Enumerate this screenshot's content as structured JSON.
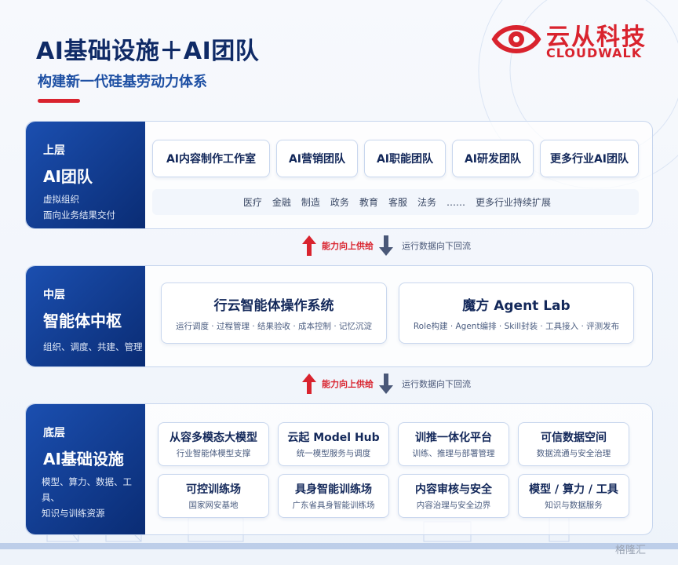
{
  "header": {
    "title": "AI基础设施＋AI团队",
    "subtitle": "构建新一代硅基劳动力体系"
  },
  "logo": {
    "cn": "云从科技",
    "en": "CLOUDWALK",
    "icon": "eye-logo-icon",
    "color": "#d9232e"
  },
  "top_layer": {
    "tier": "上层",
    "name": "AI团队",
    "desc": [
      "虚拟组织",
      "面向业务结果交付"
    ],
    "cards": [
      "AI内容制作工作室",
      "AI营销团队",
      "AI职能团队",
      "AI研发团队",
      "更多行业AI团队"
    ],
    "industries": [
      "医疗",
      "金融",
      "制造",
      "政务",
      "教育",
      "客服",
      "法务",
      "……",
      "更多行业持续扩展"
    ]
  },
  "flow": {
    "up_label": "能力向上供给",
    "down_label": "运行数据向下回流",
    "up_color": "#d9232e",
    "down_color": "#4a5878"
  },
  "middle_layer": {
    "tier": "中层",
    "name": "智能体中枢",
    "desc": "组织、调度、共建、管理",
    "cards": [
      {
        "title": "行云智能体操作系统",
        "sub": "运行调度 · 过程管理 · 结果验收 · 成本控制 · 记忆沉淀"
      },
      {
        "title": "魔方 Agent Lab",
        "sub": "Role构建 · Agent编排 · Skill封装 · 工具接入 · 评测发布"
      }
    ]
  },
  "bottom_layer": {
    "tier": "底层",
    "name": "AI基础设施",
    "desc": [
      "模型、算力、数据、工具、",
      "知识与训练资源"
    ],
    "cards": [
      {
        "title": "从容多模态大模型",
        "sub": "行业智能体模型支撑"
      },
      {
        "title": "云起 Model Hub",
        "sub": "统一模型服务与调度"
      },
      {
        "title": "训推一体化平台",
        "sub": "训练、推理与部署管理"
      },
      {
        "title": "可信数据空间",
        "sub": "数据流通与安全治理"
      },
      {
        "title": "可控训练场",
        "sub": "国家网安基地"
      },
      {
        "title": "具身智能训练场",
        "sub": "广东省具身智能训练场"
      },
      {
        "title": "内容审核与安全",
        "sub": "内容治理与安全边界"
      },
      {
        "title": "模型 / 算力 / 工具",
        "sub": "知识与数据服务"
      }
    ]
  },
  "watermark": "格隆汇"
}
